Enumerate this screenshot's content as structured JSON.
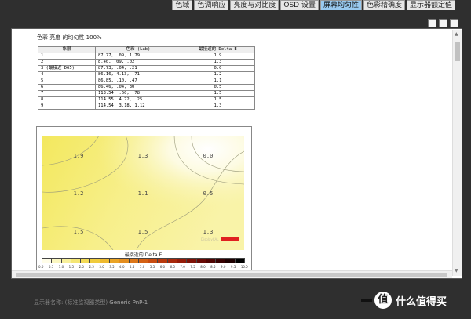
{
  "tabs": [
    {
      "label": "色域",
      "active": false
    },
    {
      "label": "色调响应",
      "active": false
    },
    {
      "label": "亮度与对比度",
      "active": false
    },
    {
      "label": "OSD 设置",
      "active": false
    },
    {
      "label": "屏幕均匀性",
      "active": true
    },
    {
      "label": "色彩精确度",
      "active": false
    },
    {
      "label": "显示器额定值",
      "active": false
    }
  ],
  "report": {
    "title": "色彩 亮度 的均匀性 100%",
    "headers": [
      "象限",
      "色彩 (Lab)",
      "最接近的 Delta E"
    ],
    "rows": [
      {
        "q": "1",
        "lab": "87.77,   .09,   1.79",
        "de": "1.9"
      },
      {
        "q": "2",
        "lab": "  8.40,   .09,    .02",
        "de": "1.3"
      },
      {
        "q": "3 (最接近 D65)",
        "lab": "87.73,   .04,    .21",
        "de": "0.0"
      },
      {
        "q": "4",
        "lab": "86.16,  4.13,    .71",
        "de": "1.2"
      },
      {
        "q": "5",
        "lab": "86.85,   .10,    .47",
        "de": "1.1"
      },
      {
        "q": "6",
        "lab": "86.46,   .04,     30",
        "de": "0.5"
      },
      {
        "q": "7",
        "lab": "113.54,   .60,    .78",
        "de": "1.5"
      },
      {
        "q": "8",
        "lab": "114.55,  4.72,    .25",
        "de": "1.5"
      },
      {
        "q": "9",
        "lab": "114.54,  3.18,   1.12",
        "de": "1.3"
      }
    ]
  },
  "chart_data": {
    "type": "heatmap",
    "title": "最接近的 Delta E",
    "grid": [
      [
        "1.9",
        "1.3",
        "0.0"
      ],
      [
        "1.2",
        "1.1",
        "0.5"
      ],
      [
        "1.5",
        "1.5",
        "1.3"
      ]
    ],
    "scale_ticks": [
      "0.0",
      "0.5",
      "1.0",
      "1.5",
      "2.0",
      "2.5",
      "3.0",
      "3.5",
      "4.0",
      "4.5",
      "5.0",
      "5.5",
      "6.0",
      "6.5",
      "7.0",
      "7.5",
      "8.0",
      "8.5",
      "9.0",
      "9.5",
      "10.0"
    ],
    "scale_colors": [
      "#fffde8",
      "#fbf7c0",
      "#f8f09a",
      "#f5e674",
      "#f3da55",
      "#f0cb3c",
      "#eeb92e",
      "#eaa425",
      "#e48e1f",
      "#dd7719",
      "#d46114",
      "#c84c10",
      "#b9390d",
      "#a8290b",
      "#951c09",
      "#7f1207",
      "#680a05",
      "#500503",
      "#380202",
      "#1e0101",
      "#000000"
    ],
    "marker_label": "DisplayCAL"
  },
  "footer": {
    "label": "显示器名称: (标准监视器类型)",
    "value": "Generic PnP-1"
  },
  "watermark": {
    "logo": "值",
    "text": "什么值得买"
  },
  "colors": {
    "active_tab": "#99c9ef",
    "marker": "#e02020"
  }
}
